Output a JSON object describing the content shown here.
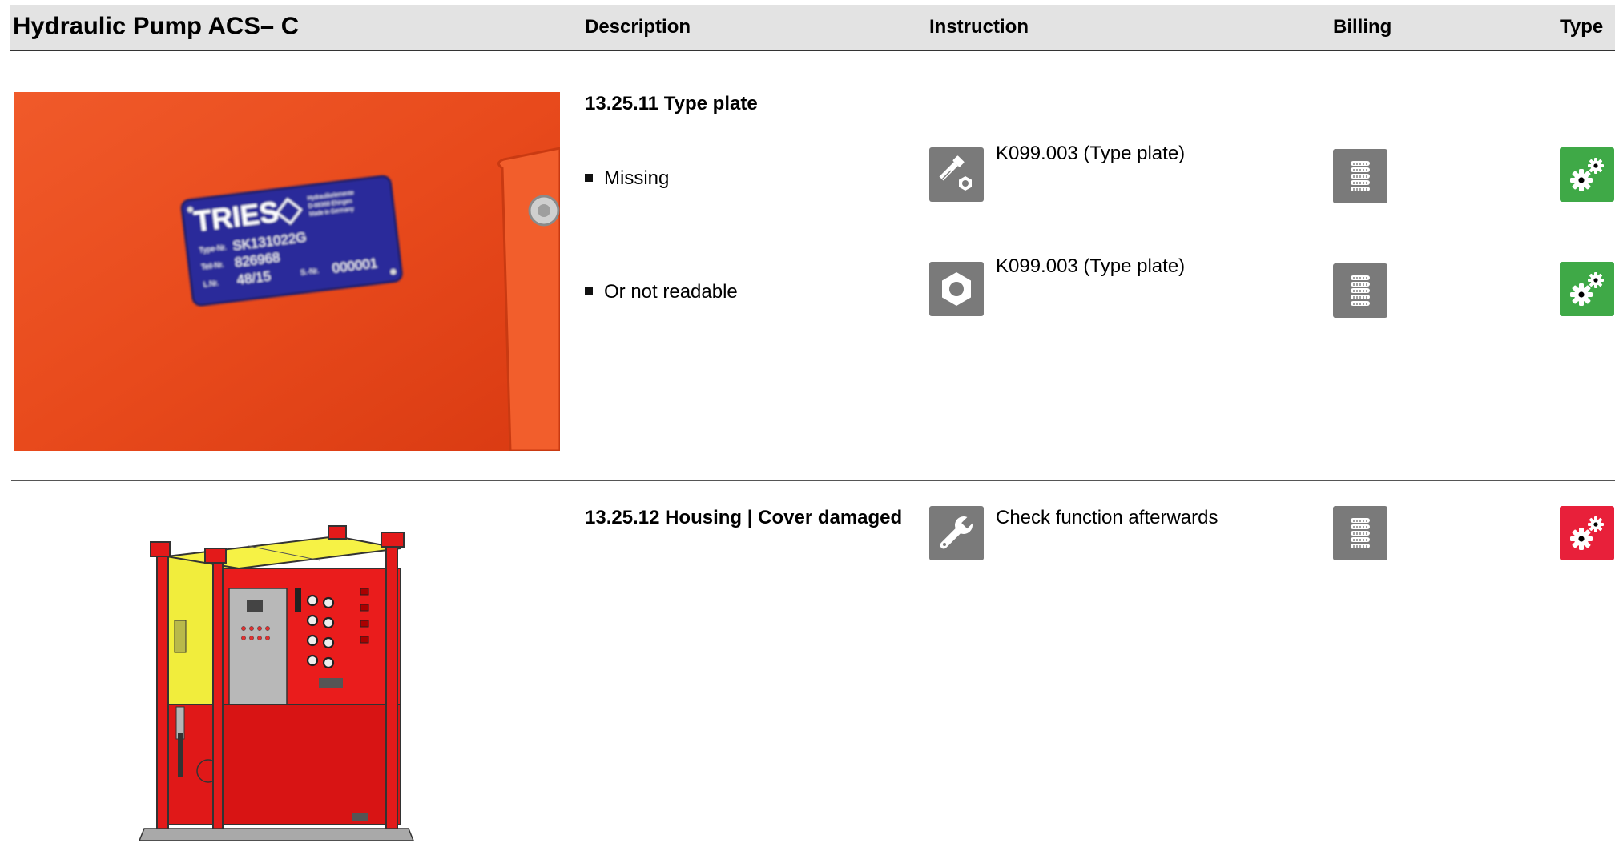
{
  "header": {
    "title": "Hydraulic Pump ACS– C",
    "columns": {
      "description": "Description",
      "instruction": "Instruction",
      "billing": "Billing",
      "type": "Type"
    }
  },
  "sections": [
    {
      "heading": "13.25.11 Type plate",
      "photo": {
        "plate_brand": "TRIES",
        "plate_small_1": "Hydraulikelemente",
        "plate_small_2": "D-88368 Ehingen",
        "plate_small_3": "Made in Germany",
        "type_label": "Type-Nr.",
        "type_value": "SK131022G",
        "teil_label": "Teil-Nr.",
        "teil_value": "826968",
        "lot_label": "L.Nr.",
        "lot_value": "48/15",
        "serial_label": "S.-Nr.",
        "serial_value": "000001"
      },
      "rows": [
        {
          "text": "Missing",
          "instruction_icon": "screw-nut-icon",
          "instruction": "K099.003 (Type plate)",
          "billing_icon": "coin-stack-icon",
          "type_icon": "gears-icon",
          "type_color": "#3fa947"
        },
        {
          "text": "Or not readable",
          "instruction_icon": "nut-icon",
          "instruction": "K099.003 (Type plate)",
          "billing_icon": "coin-stack-icon",
          "type_icon": "gears-icon",
          "type_color": "#3fa947"
        }
      ]
    },
    {
      "heading": "13.25.12 Housing | Cover  damaged",
      "rows": [
        {
          "instruction_icon": "wrench-icon",
          "instruction": "Check function afterwards",
          "billing_icon": "coin-stack-icon",
          "type_icon": "gears-icon",
          "type_color": "#e8203a"
        }
      ]
    }
  ]
}
